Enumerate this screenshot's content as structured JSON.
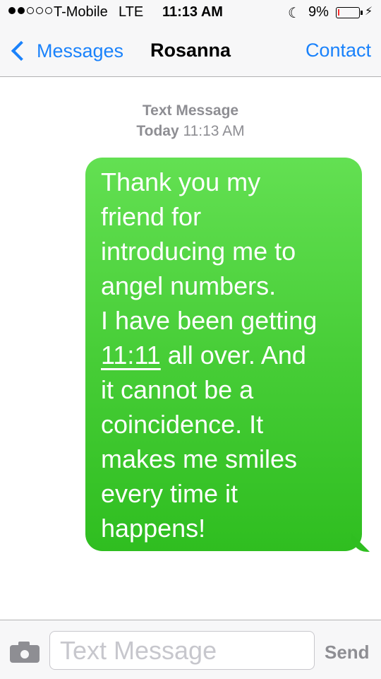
{
  "status_bar": {
    "carrier": "T-Mobile",
    "network": "LTE",
    "time": "11:13 AM",
    "battery_percent": "9%",
    "battery_level": 0.09,
    "signal_bars_filled": 2,
    "signal_bars_total": 5
  },
  "nav": {
    "back_label": "Messages",
    "title": "Rosanna",
    "contact_label": "Contact"
  },
  "thread": {
    "header_label": "Text Message",
    "day": "Today",
    "time": "11:13 AM"
  },
  "message": {
    "lines": [
      "Thank you my",
      "friend for",
      "introducing me to",
      "angel numbers.",
      "I have been getting",
      "11:11",
      " all over. And",
      "it cannot be a",
      "coincidence. It",
      "makes me smiles",
      "every time it",
      "happens!"
    ],
    "bubble_color": "#4cd137"
  },
  "composer": {
    "placeholder": "Text Message",
    "send_label": "Send"
  },
  "colors": {
    "accent": "#1a82fb",
    "bubble_green": "#45cc35",
    "battery_low": "#ff2d2d",
    "muted": "#8e8e93"
  }
}
